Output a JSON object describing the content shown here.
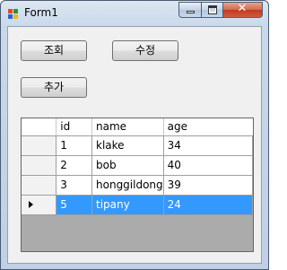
{
  "window": {
    "title": "Form1",
    "close_glyph": "✕"
  },
  "buttons": {
    "lookup": "조회",
    "edit": "수정",
    "add": "추가"
  },
  "grid": {
    "columns": [
      "id",
      "name",
      "age"
    ],
    "rows": [
      {
        "id": "1",
        "name": "klake",
        "age": "34"
      },
      {
        "id": "2",
        "name": "bob",
        "age": "40"
      },
      {
        "id": "3",
        "name": "honggildong",
        "age": "39"
      },
      {
        "id": "5",
        "name": "tipany",
        "age": "24"
      }
    ],
    "selected_row_index": 3
  },
  "colors": {
    "selection": "#3399ff",
    "grid_background": "#ababab"
  }
}
